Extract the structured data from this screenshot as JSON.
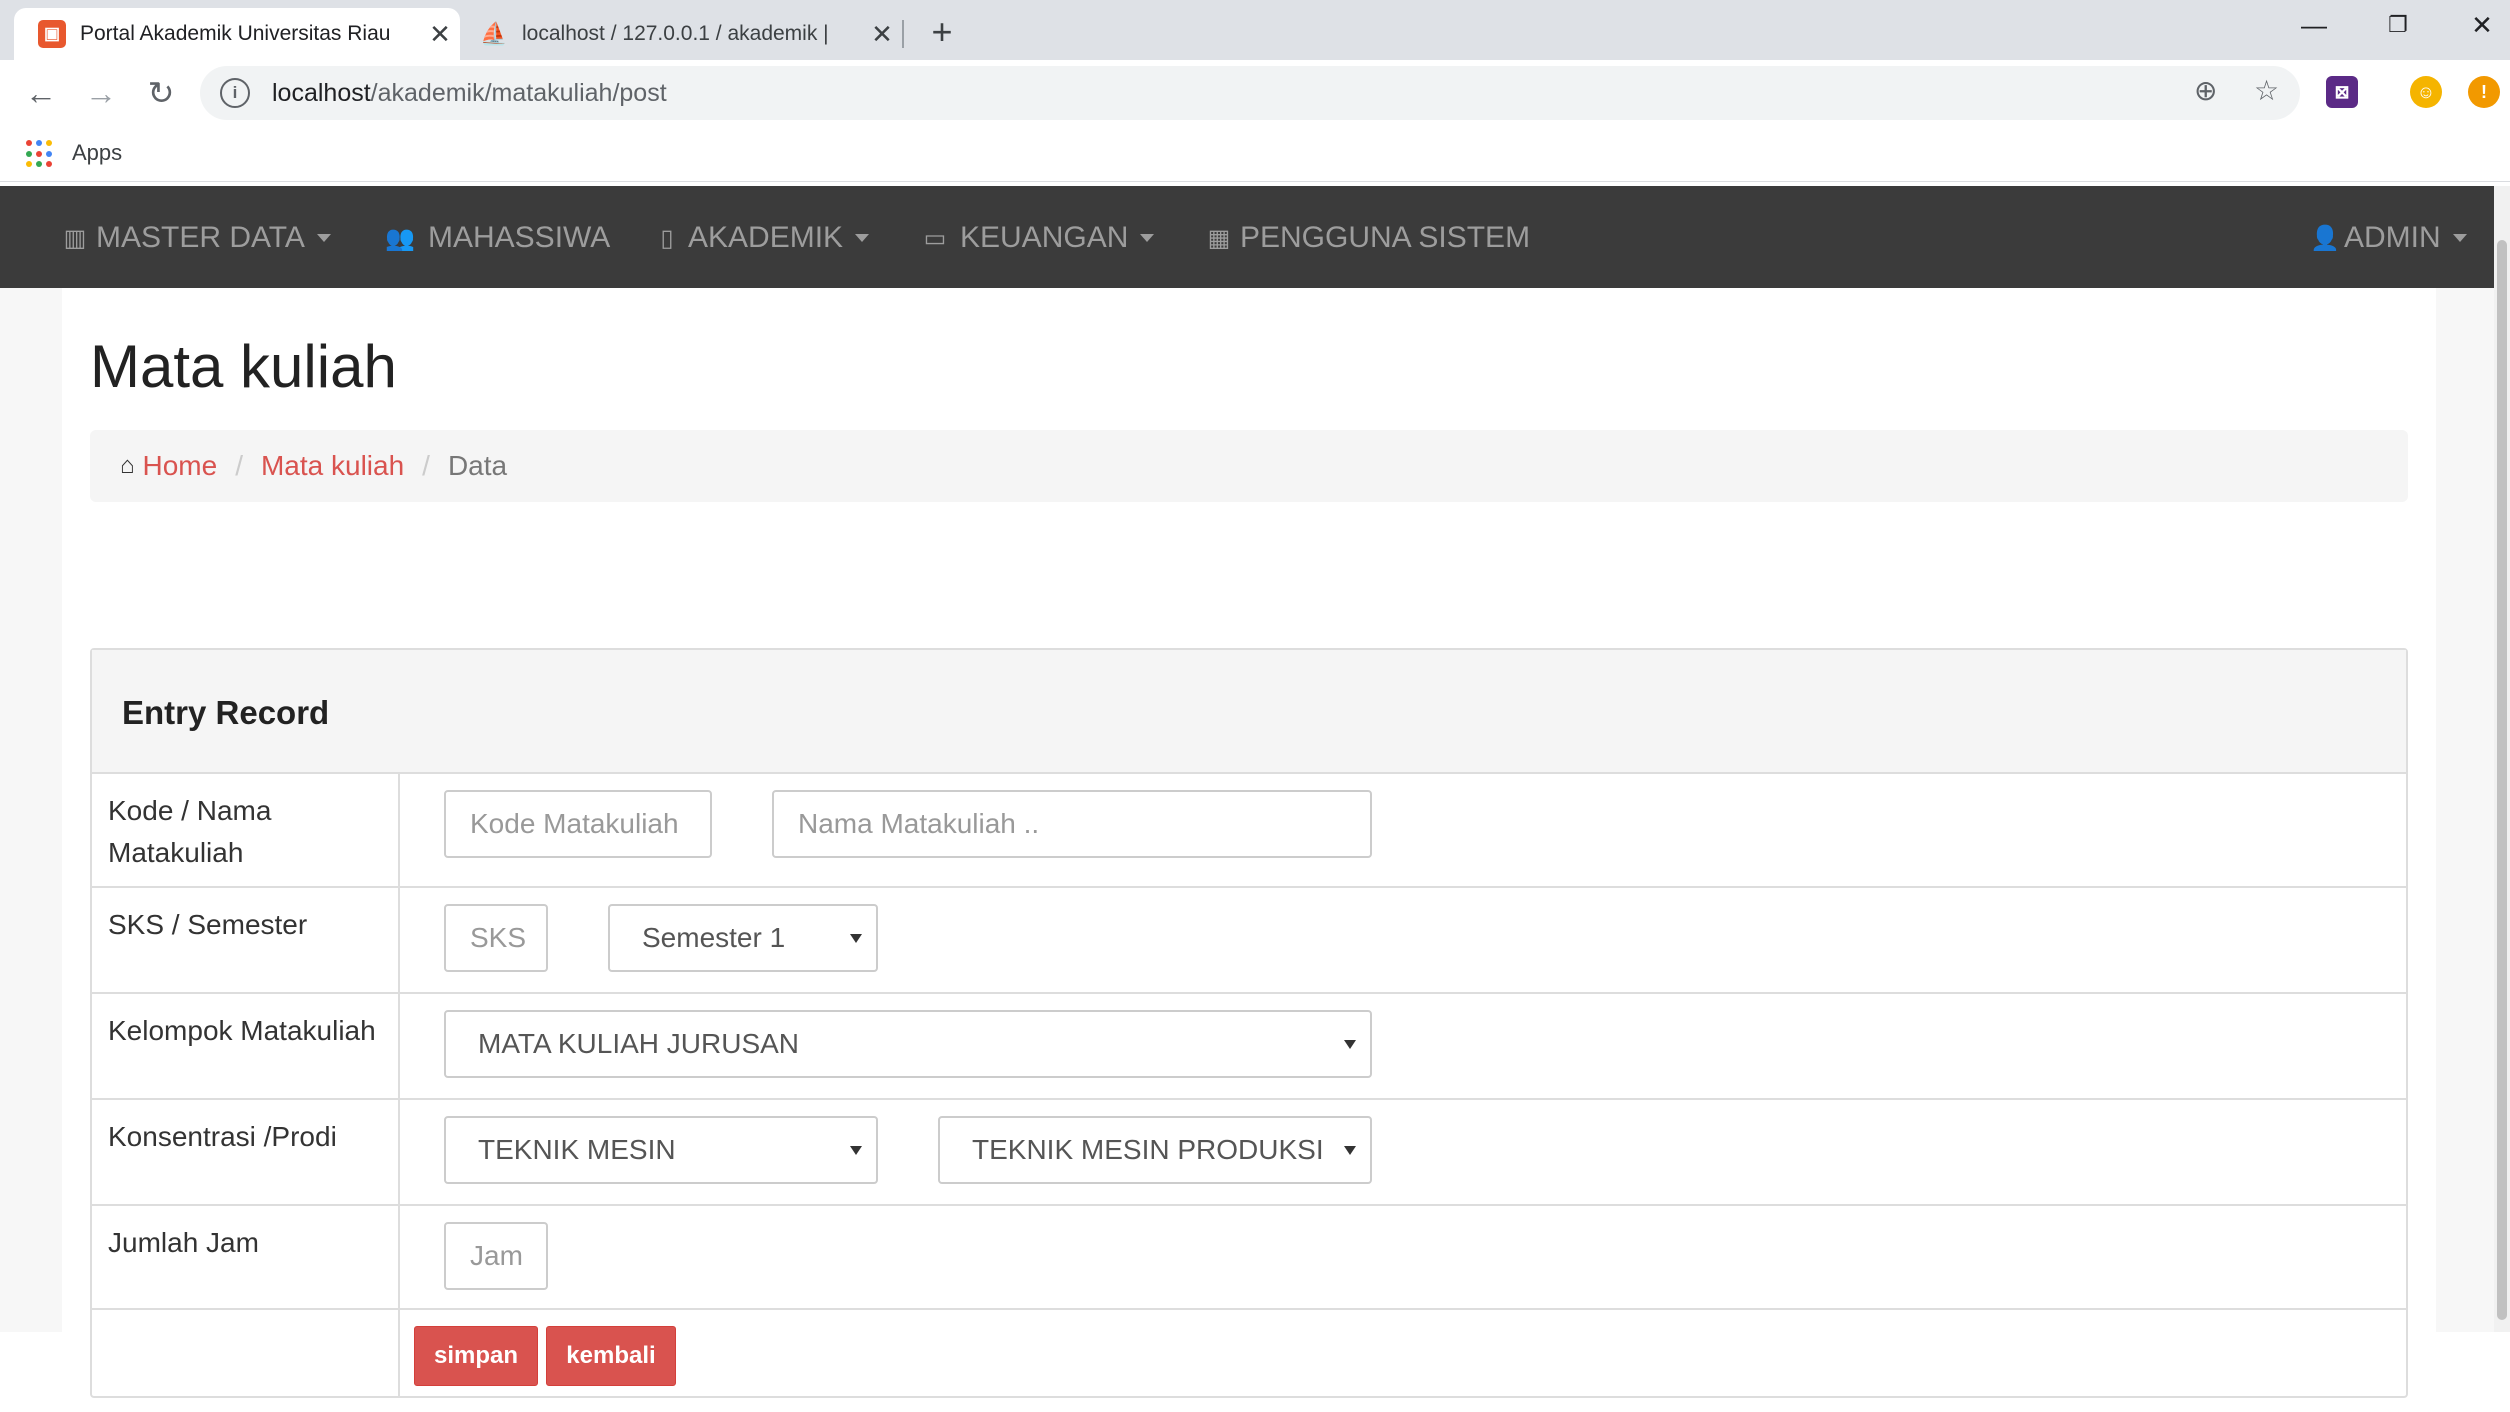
{
  "browser": {
    "tabs": [
      {
        "title": "Portal Akademik Universitas Riau",
        "active": true
      },
      {
        "title": "localhost / 127.0.0.1 / akademik |",
        "active": false
      }
    ],
    "close_glyph": "✕",
    "new_tab_glyph": "+",
    "url_host": "localhost",
    "url_path": "/akademik/matakuliah/post",
    "bookmarks_label": "Apps"
  },
  "navbar": {
    "items": [
      {
        "label": "MASTER DATA",
        "icon": "chart-icon",
        "dropdown": true
      },
      {
        "label": "MAHASSIWA",
        "icon": "users-icon",
        "dropdown": false
      },
      {
        "label": "AKADEMIK",
        "icon": "book-icon",
        "dropdown": true
      },
      {
        "label": "KEUANGAN",
        "icon": "money-icon",
        "dropdown": true
      },
      {
        "label": "PENGGUNA SISTEM",
        "icon": "grid-icon",
        "dropdown": false
      }
    ],
    "user": {
      "label": "ADMIN",
      "icon": "user-icon"
    }
  },
  "page": {
    "title": "Mata kuliah",
    "breadcrumb": {
      "home": "Home",
      "section": "Mata kuliah",
      "current": "Data",
      "separator": "/"
    }
  },
  "panel": {
    "title": "Entry Record",
    "rows": {
      "kode_nama": {
        "label": "Kode / Nama Matakuliah",
        "kode_placeholder": "Kode Matakuliah",
        "nama_placeholder": "Nama Matakuliah .."
      },
      "sks_semester": {
        "label": "SKS / Semester",
        "sks_placeholder": "SKS",
        "semester_value": "Semester 1"
      },
      "kelompok": {
        "label": "Kelompok Matakuliah",
        "value": "MATA KULIAH JURUSAN"
      },
      "konsentrasi": {
        "label": "Konsentrasi /Prodi",
        "konsentrasi_value": "TEKNIK MESIN",
        "prodi_value": "TEKNIK MESIN PRODUKSI"
      },
      "jam": {
        "label": "Jumlah Jam",
        "placeholder": "Jam"
      }
    },
    "buttons": {
      "save": "simpan",
      "back": "kembali"
    }
  },
  "colors": {
    "navbar_bg": "#3b3b3b",
    "navbar_text": "#9d9d9d",
    "accent": "#d9534f"
  }
}
